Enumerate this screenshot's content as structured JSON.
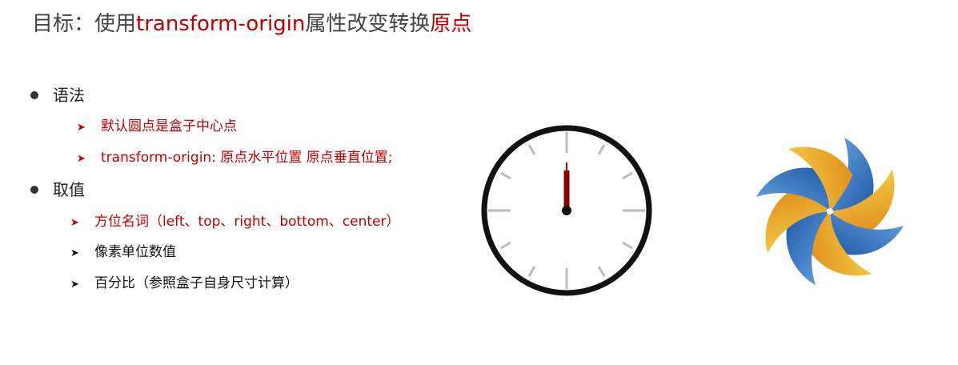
{
  "title": {
    "prefix": "目标：使用",
    "highlight": "transform-origin",
    "middle": "属性改变转换",
    "suffix": "原点"
  },
  "sections": [
    {
      "label": "语法",
      "items": [
        {
          "text": "默认圆点是盒子中心点"
        },
        {
          "text": "transform-origin:  原点水平位置   原点垂直位置;"
        }
      ]
    },
    {
      "label": "取值",
      "items": [
        {
          "text": "方位名词（left、top、right、bottom、center）"
        },
        {
          "text": "像素单位数值"
        },
        {
          "text": "百分比（参照盒子自身尺寸计算）"
        }
      ]
    }
  ],
  "icons": {
    "bullet": "bullet-dot-icon",
    "arrow": "arrow-right-icon",
    "clock": "clock-icon",
    "pinwheel": "pinwheel-icon"
  },
  "colors": {
    "accent": "#c00000",
    "text": "#222222",
    "title": "#444444",
    "clock_ring": "#111111",
    "clock_ticks": "#bbbbbb",
    "pinwheel_blue": "#2e6fbf",
    "pinwheel_yellow": "#f2c230"
  }
}
